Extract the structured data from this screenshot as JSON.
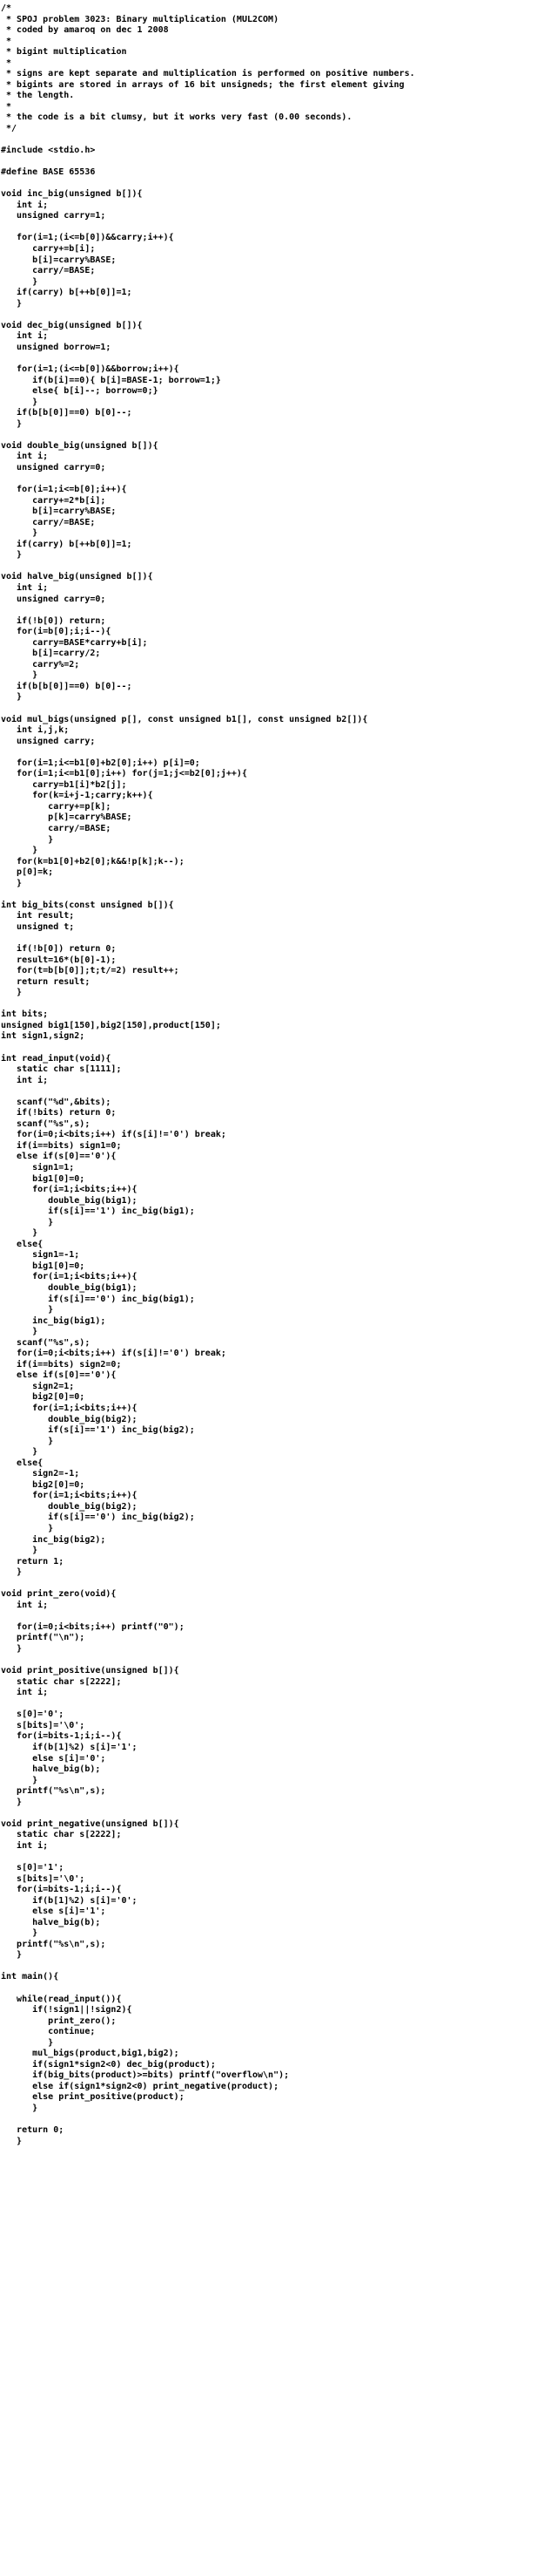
{
  "document": {
    "lines": [
      "/*",
      " * SPOJ problem 3023: Binary multiplication (MUL2COM)",
      " * coded by amaroq on dec 1 2008",
      " *",
      " * bigint multiplication",
      " *",
      " * signs are kept separate and multiplication is performed on positive numbers.",
      " * bigints are stored in arrays of 16 bit unsigneds; the first element giving",
      " * the length.",
      " *",
      " * the code is a bit clumsy, but it works very fast (0.00 seconds).",
      " */",
      "",
      "#include <stdio.h>",
      "",
      "#define BASE 65536",
      "",
      "void inc_big(unsigned b[]){",
      "   int i;",
      "   unsigned carry=1;",
      "",
      "   for(i=1;(i<=b[0])&&carry;i++){",
      "      carry+=b[i];",
      "      b[i]=carry%BASE;",
      "      carry/=BASE;",
      "      }",
      "   if(carry) b[++b[0]]=1;",
      "   }",
      "",
      "void dec_big(unsigned b[]){",
      "   int i;",
      "   unsigned borrow=1;",
      "",
      "   for(i=1;(i<=b[0])&&borrow;i++){",
      "      if(b[i]==0){ b[i]=BASE-1; borrow=1;}",
      "      else{ b[i]--; borrow=0;}",
      "      }",
      "   if(b[b[0]]==0) b[0]--;",
      "   }",
      "",
      "void double_big(unsigned b[]){",
      "   int i;",
      "   unsigned carry=0;",
      "",
      "   for(i=1;i<=b[0];i++){",
      "      carry+=2*b[i];",
      "      b[i]=carry%BASE;",
      "      carry/=BASE;",
      "      }",
      "   if(carry) b[++b[0]]=1;",
      "   }",
      "",
      "void halve_big(unsigned b[]){",
      "   int i;",
      "   unsigned carry=0;",
      "",
      "   if(!b[0]) return;",
      "   for(i=b[0];i;i--){",
      "      carry=BASE*carry+b[i];",
      "      b[i]=carry/2;",
      "      carry%=2;",
      "      }",
      "   if(b[b[0]]==0) b[0]--;",
      "   }",
      "",
      "void mul_bigs(unsigned p[], const unsigned b1[], const unsigned b2[]){",
      "   int i,j,k;",
      "   unsigned carry;",
      "",
      "   for(i=1;i<=b1[0]+b2[0];i++) p[i]=0;",
      "   for(i=1;i<=b1[0];i++) for(j=1;j<=b2[0];j++){",
      "      carry=b1[i]*b2[j];",
      "      for(k=i+j-1;carry;k++){",
      "         carry+=p[k];",
      "         p[k]=carry%BASE;",
      "         carry/=BASE;",
      "         }",
      "      }",
      "   for(k=b1[0]+b2[0];k&&!p[k];k--);",
      "   p[0]=k;",
      "   }",
      "",
      "int big_bits(const unsigned b[]){",
      "   int result;",
      "   unsigned t;",
      "",
      "   if(!b[0]) return 0;",
      "   result=16*(b[0]-1);",
      "   for(t=b[b[0]];t;t/=2) result++;",
      "   return result;",
      "   }",
      "",
      "int bits;",
      "unsigned big1[150],big2[150],product[150];",
      "int sign1,sign2;",
      "",
      "int read_input(void){",
      "   static char s[1111];",
      "   int i;",
      "",
      "   scanf(\"%d\",&bits);",
      "   if(!bits) return 0;",
      "   scanf(\"%s\",s);",
      "   for(i=0;i<bits;i++) if(s[i]!='0') break;",
      "   if(i==bits) sign1=0;",
      "   else if(s[0]=='0'){",
      "      sign1=1;",
      "      big1[0]=0;",
      "      for(i=1;i<bits;i++){",
      "         double_big(big1);",
      "         if(s[i]=='1') inc_big(big1);",
      "         }",
      "      }",
      "   else{",
      "      sign1=-1;",
      "      big1[0]=0;",
      "      for(i=1;i<bits;i++){",
      "         double_big(big1);",
      "         if(s[i]=='0') inc_big(big1);",
      "         }",
      "      inc_big(big1);",
      "      }",
      "   scanf(\"%s\",s);",
      "   for(i=0;i<bits;i++) if(s[i]!='0') break;",
      "   if(i==bits) sign2=0;",
      "   else if(s[0]=='0'){",
      "      sign2=1;",
      "      big2[0]=0;",
      "      for(i=1;i<bits;i++){",
      "         double_big(big2);",
      "         if(s[i]=='1') inc_big(big2);",
      "         }",
      "      }",
      "   else{",
      "      sign2=-1;",
      "      big2[0]=0;",
      "      for(i=1;i<bits;i++){",
      "         double_big(big2);",
      "         if(s[i]=='0') inc_big(big2);",
      "         }",
      "      inc_big(big2);",
      "      }",
      "   return 1;",
      "   }",
      "",
      "void print_zero(void){",
      "   int i;",
      "",
      "   for(i=0;i<bits;i++) printf(\"0\");",
      "   printf(\"\\n\");",
      "   }",
      "",
      "void print_positive(unsigned b[]){",
      "   static char s[2222];",
      "   int i;",
      "",
      "   s[0]='0';",
      "   s[bits]='\\0';",
      "   for(i=bits-1;i;i--){",
      "      if(b[1]%2) s[i]='1';",
      "      else s[i]='0';",
      "      halve_big(b);",
      "      }",
      "   printf(\"%s\\n\",s);",
      "   }",
      "",
      "void print_negative(unsigned b[]){",
      "   static char s[2222];",
      "   int i;",
      "",
      "   s[0]='1';",
      "   s[bits]='\\0';",
      "   for(i=bits-1;i;i--){",
      "      if(b[1]%2) s[i]='0';",
      "      else s[i]='1';",
      "      halve_big(b);",
      "      }",
      "   printf(\"%s\\n\",s);",
      "   }",
      "",
      "int main(){",
      "",
      "   while(read_input()){",
      "      if(!sign1||!sign2){",
      "         print_zero();",
      "         continue;",
      "         }",
      "      mul_bigs(product,big1,big2);",
      "      if(sign1*sign2<0) dec_big(product);",
      "      if(big_bits(product)>=bits) printf(\"overflow\\n\");",
      "      else if(sign1*sign2<0) print_negative(product);",
      "      else print_positive(product);",
      "      }",
      "",
      "   return 0;",
      "   }"
    ]
  }
}
